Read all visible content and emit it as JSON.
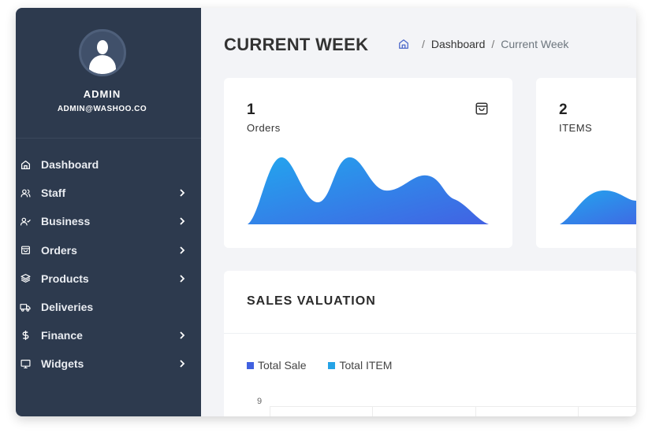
{
  "profile": {
    "name": "ADMIN",
    "email": "ADMIN@WASHOO.CO"
  },
  "menu": [
    {
      "label": "Dashboard",
      "icon": "home-icon",
      "has_arrow": false
    },
    {
      "label": "Staff",
      "icon": "users-icon",
      "has_arrow": true
    },
    {
      "label": "Business",
      "icon": "user-check-icon",
      "has_arrow": true
    },
    {
      "label": "Orders",
      "icon": "shopping-bag-icon",
      "has_arrow": true
    },
    {
      "label": "Products",
      "icon": "layers-icon",
      "has_arrow": true
    },
    {
      "label": "Deliveries",
      "icon": "truck-icon",
      "has_arrow": false
    },
    {
      "label": "Finance",
      "icon": "dollar-icon",
      "has_arrow": true
    },
    {
      "label": "Widgets",
      "icon": "monitor-icon",
      "has_arrow": true
    }
  ],
  "header": {
    "title": "CURRENT WEEK",
    "breadcrumb": {
      "home_icon": "home-icon",
      "link": "Dashboard",
      "separator": "/",
      "current": "Current Week"
    }
  },
  "cards": [
    {
      "value": "1",
      "label": "Orders",
      "icon": "shopping-bag-icon"
    },
    {
      "value": "2",
      "label": "ITEMS"
    }
  ],
  "sales": {
    "title": "SALES VALUATION",
    "legend": [
      {
        "label": "Total Sale",
        "color": "#4161e0"
      },
      {
        "label": "Total ITEM",
        "color": "#25a3e6"
      }
    ],
    "y_tick_top": "9"
  },
  "colors": {
    "sidebar": "#2d3a4e",
    "wave_start": "#22a6ee",
    "wave_end": "#4163e3"
  }
}
